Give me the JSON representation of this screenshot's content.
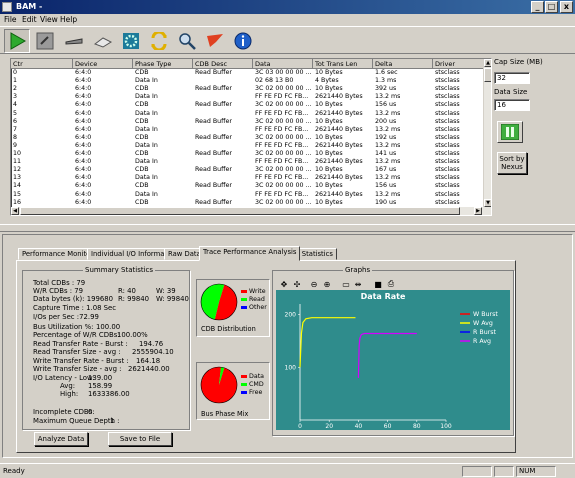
{
  "window": {
    "title": "BAM -",
    "min": "_",
    "max": "□",
    "close": "x"
  },
  "menu": [
    "File",
    "Edit",
    "View",
    "Help"
  ],
  "toolbar": {
    "icons": [
      "play-icon",
      "stop-icon",
      "probe-icon",
      "scanner-icon",
      "settings-gear-icon",
      "swap-arrows-icon",
      "search-icon",
      "flag-icon",
      "info-icon"
    ]
  },
  "trace": {
    "columns": [
      "Ctr",
      "Device",
      "Phase Type",
      "CDB Desc",
      "Data",
      "Tot Trans Len",
      "Delta",
      "Driver"
    ],
    "rows": [
      [
        "0",
        "6:4:0",
        "CDB",
        "Read Buffer",
        "3C 03 00 00 00 ...",
        "10 Bytes",
        "1.6 sec",
        "stsclass"
      ],
      [
        "1",
        "6:4:0",
        "Data In",
        "",
        "02 68 13 B0",
        "4 Bytes",
        "1.3 ms",
        "stsclass"
      ],
      [
        "2",
        "6:4:0",
        "CDB",
        "Read Buffer",
        "3C 02 00 00 00 ...",
        "10 Bytes",
        "392 us",
        "stsclass"
      ],
      [
        "3",
        "6:4:0",
        "Data In",
        "",
        "FF FE FD FC FB...",
        "2621440 Bytes",
        "13.2 ms",
        "stsclass"
      ],
      [
        "4",
        "6:4:0",
        "CDB",
        "Read Buffer",
        "3C 02 00 00 00 ...",
        "10 Bytes",
        "156 us",
        "stsclass"
      ],
      [
        "5",
        "6:4:0",
        "Data In",
        "",
        "FF FE FD FC FB...",
        "2621440 Bytes",
        "13.2 ms",
        "stsclass"
      ],
      [
        "6",
        "6:4:0",
        "CDB",
        "Read Buffer",
        "3C 02 00 00 00 ...",
        "10 Bytes",
        "200 us",
        "stsclass"
      ],
      [
        "7",
        "6:4:0",
        "Data In",
        "",
        "FF FE FD FC FB...",
        "2621440 Bytes",
        "13.2 ms",
        "stsclass"
      ],
      [
        "8",
        "6:4:0",
        "CDB",
        "Read Buffer",
        "3C 02 00 00 00 ...",
        "10 Bytes",
        "192 us",
        "stsclass"
      ],
      [
        "9",
        "6:4:0",
        "Data In",
        "",
        "FF FE FD FC FB...",
        "2621440 Bytes",
        "13.2 ms",
        "stsclass"
      ],
      [
        "10",
        "6:4:0",
        "CDB",
        "Read Buffer",
        "3C 02 00 00 00 ...",
        "10 Bytes",
        "141 us",
        "stsclass"
      ],
      [
        "11",
        "6:4:0",
        "Data In",
        "",
        "FF FE FD FC FB...",
        "2621440 Bytes",
        "13.2 ms",
        "stsclass"
      ],
      [
        "12",
        "6:4:0",
        "CDB",
        "Read Buffer",
        "3C 02 00 00 00 ...",
        "10 Bytes",
        "167 us",
        "stsclass"
      ],
      [
        "13",
        "6:4:0",
        "Data In",
        "",
        "FF FE FD FC FB...",
        "2621440 Bytes",
        "13.2 ms",
        "stsclass"
      ],
      [
        "14",
        "6:4:0",
        "CDB",
        "Read Buffer",
        "3C 02 00 00 00 ...",
        "10 Bytes",
        "156 us",
        "stsclass"
      ],
      [
        "15",
        "6:4:0",
        "Data In",
        "",
        "FF FE FD FC FB...",
        "2621440 Bytes",
        "13.2 ms",
        "stsclass"
      ],
      [
        "16",
        "6:4:0",
        "CDB",
        "Read Buffer",
        "3C 02 00 00 00 ...",
        "10 Bytes",
        "190 us",
        "stsclass"
      ]
    ]
  },
  "side": {
    "cap_size_label": "Cap Size (MB)",
    "cap_size_value": "32",
    "data_size_label": "Data Size",
    "data_size_value": "16",
    "sort_button": "Sort by Nexus"
  },
  "tabs": [
    "Performance Monitors",
    "Individual I/O Information",
    "Raw Data",
    "Trace Performance Analysis",
    "I/O Statistics"
  ],
  "selected_tab_index": 3,
  "summary": {
    "title": "Summary Statistics",
    "lines": [
      "Total CDBs : 79",
      "W/R CDBs :  79",
      "Data bytes (k): 199680",
      "Capture Time : 1.08 Sec",
      "I/Os per Sec :72.99",
      "Bus Utilization %:",
      "Percentage of W/R CDBs:",
      "Read Transfer Rate - Burst :",
      "Read Transfer Size - avg :",
      "Write Transfer Rate - Burst :",
      "Write Transfer Size - avg :",
      "I/O Latency - Low:",
      "Avg:",
      "High:",
      "Incomplete CDBs:",
      "Maximum Queue Depth :"
    ],
    "r_count": "R:  40",
    "w_count": "W:  39",
    "r_bytes": "R:  99840",
    "w_bytes": "W:  99840",
    "bus_util": "100.00",
    "pct_wr": "100.00%",
    "read_burst": "194.76",
    "read_size": "2555904.10",
    "write_burst": "164.18",
    "write_size": "2621440.00",
    "lat_low": "139.00",
    "lat_avg": "158.99",
    "lat_high": "1633386.00",
    "incomplete": "0",
    "queue_depth": "1"
  },
  "cdb_distribution": {
    "title": "CDB Distribution",
    "legend": [
      "Write",
      "Read",
      "Other"
    ],
    "colors": [
      "#ff0000",
      "#00ff00",
      "#0000ff"
    ],
    "fractions": [
      0.49,
      0.51,
      0.0
    ]
  },
  "bus_phase": {
    "title": "Bus Phase Mix",
    "legend": [
      "Data",
      "CMD",
      "Free"
    ],
    "colors": [
      "#ff0000",
      "#00ff00",
      "#0000ff"
    ],
    "fractions": [
      0.97,
      0.03,
      0.0
    ]
  },
  "graphs_group_title": "Graphs",
  "graph_toolbar_icons": [
    "pan-icon",
    "select-icon",
    "zoom-out-icon",
    "zoom-in-icon",
    "frame-icon",
    "fit-icon",
    "save-icon",
    "print-icon"
  ],
  "buttons": {
    "analyze": "Analyze Data",
    "save": "Save to File"
  },
  "status": {
    "text": "Ready",
    "num": "NUM"
  },
  "chart_data": {
    "type": "line",
    "title": "Data Rate",
    "xlim": [
      0,
      100
    ],
    "ylim": [
      0,
      220
    ],
    "xticks": [
      "0",
      "20",
      "40",
      "60",
      "80",
      "100"
    ],
    "yticks": [
      "100",
      "200"
    ],
    "grid": false,
    "legend_position": "right",
    "background": "#2f8c8c",
    "series": [
      {
        "name": "W Burst",
        "color": "#ff0000",
        "x": [],
        "y": []
      },
      {
        "name": "W Avg",
        "color": "#ffff00",
        "x": [
          0,
          1,
          2,
          4,
          8,
          16,
          24,
          30,
          34,
          38
        ],
        "y": [
          100,
          165,
          185,
          192,
          194,
          194,
          194,
          194,
          194,
          194
        ]
      },
      {
        "name": "R Burst",
        "color": "#0000ff",
        "x": [],
        "y": []
      },
      {
        "name": "R Avg",
        "color": "#d400ff",
        "x": [
          40,
          40.5,
          41,
          42,
          44,
          48,
          56,
          64,
          72,
          80
        ],
        "y": [
          80,
          140,
          155,
          162,
          164,
          164,
          164,
          164,
          164,
          164
        ]
      }
    ]
  }
}
